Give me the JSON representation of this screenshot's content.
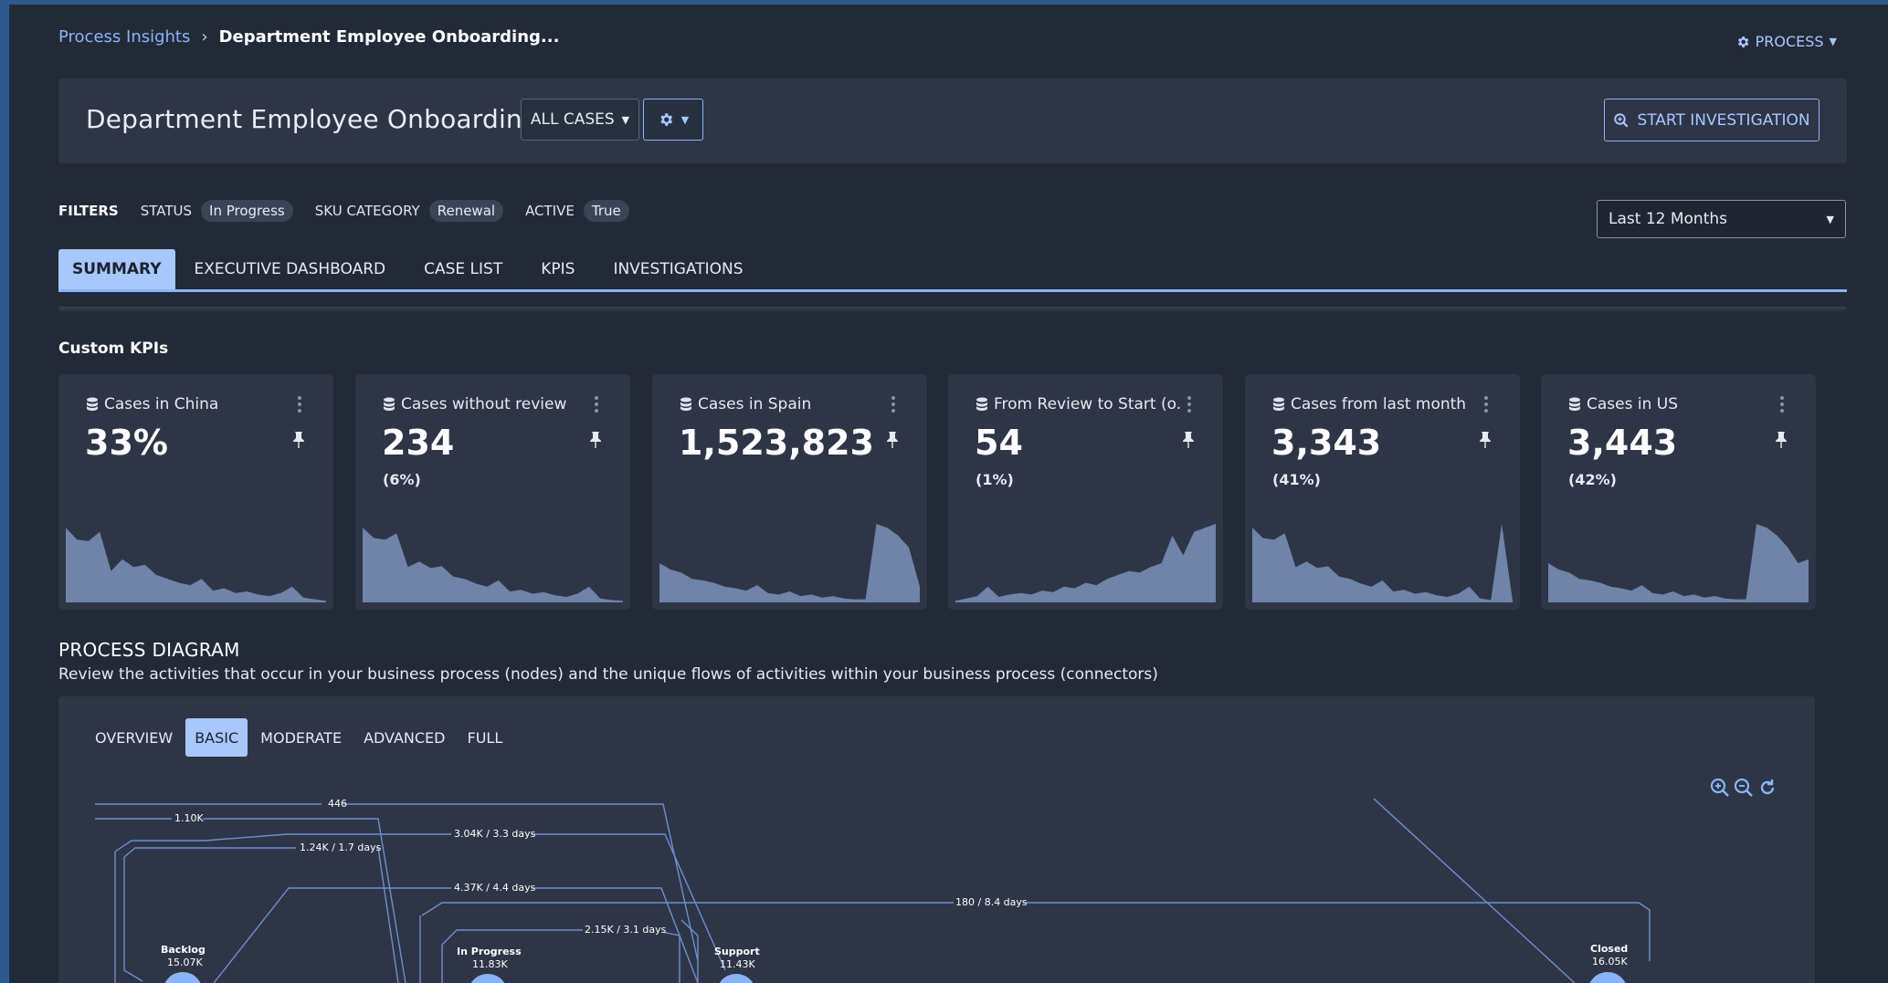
{
  "breadcrumb": {
    "parent": "Process Insights",
    "separator": "›",
    "current": "Department Employee Onboarding..."
  },
  "process_menu": {
    "label": "PROCESS",
    "icon": "gear-icon"
  },
  "header": {
    "title": "Department Employee Onboarding",
    "cases_dropdown": "ALL CASES",
    "settings_icon": "gear-icon",
    "start_investigation": "START INVESTIGATION"
  },
  "filters": {
    "label": "FILTERS",
    "items": [
      {
        "label": "STATUS",
        "value": "In Progress"
      },
      {
        "label": "SKU CATEGORY",
        "value": "Renewal"
      },
      {
        "label": "ACTIVE",
        "value": "True"
      }
    ]
  },
  "date_range": {
    "selected": "Last 12 Months"
  },
  "tabs": [
    {
      "label": "SUMMARY",
      "active": true
    },
    {
      "label": "EXECUTIVE DASHBOARD",
      "active": false
    },
    {
      "label": "CASE LIST",
      "active": false
    },
    {
      "label": "KPIS",
      "active": false
    },
    {
      "label": "INVESTIGATIONS",
      "active": false
    }
  ],
  "custom_kpis": {
    "title": "Custom KPIs",
    "cards": [
      {
        "title": "Cases in China",
        "value": "33%",
        "sub": "",
        "spark": [
          0.95,
          0.8,
          0.78,
          0.9,
          0.4,
          0.55,
          0.45,
          0.48,
          0.35,
          0.3,
          0.25,
          0.22,
          0.3,
          0.15,
          0.18,
          0.12,
          0.14,
          0.1,
          0.08,
          0.12,
          0.2,
          0.06,
          0.04,
          0.02
        ]
      },
      {
        "title": "Cases without review",
        "value": "234",
        "sub": "(6%)",
        "spark": [
          0.95,
          0.82,
          0.8,
          0.88,
          0.45,
          0.52,
          0.44,
          0.46,
          0.33,
          0.3,
          0.24,
          0.2,
          0.28,
          0.14,
          0.16,
          0.11,
          0.13,
          0.09,
          0.07,
          0.11,
          0.2,
          0.05,
          0.03,
          0.02
        ]
      },
      {
        "title": "Cases in Spain",
        "value": "1,523,823",
        "sub": "",
        "spark": [
          0.5,
          0.42,
          0.38,
          0.3,
          0.28,
          0.25,
          0.2,
          0.18,
          0.15,
          0.22,
          0.12,
          0.1,
          0.14,
          0.08,
          0.1,
          0.06,
          0.08,
          0.05,
          0.04,
          0.04,
          1.0,
          0.95,
          0.85,
          0.7,
          0.2
        ]
      },
      {
        "title": "From Review to Start (o...",
        "value": "54",
        "sub": "(1%)",
        "spark": [
          0.02,
          0.05,
          0.08,
          0.2,
          0.07,
          0.1,
          0.12,
          0.1,
          0.15,
          0.13,
          0.2,
          0.18,
          0.25,
          0.22,
          0.3,
          0.35,
          0.4,
          0.38,
          0.45,
          0.5,
          0.85,
          0.6,
          0.9,
          0.95,
          1.0
        ]
      },
      {
        "title": "Cases from last month",
        "value": "3,343",
        "sub": "(41%)",
        "spark": [
          0.95,
          0.82,
          0.8,
          0.88,
          0.45,
          0.52,
          0.44,
          0.46,
          0.33,
          0.3,
          0.24,
          0.2,
          0.28,
          0.14,
          0.16,
          0.11,
          0.13,
          0.09,
          0.07,
          0.11,
          0.2,
          0.05,
          0.03,
          1.0,
          0.02
        ]
      },
      {
        "title": "Cases in US",
        "value": "3,443",
        "sub": "(42%)",
        "spark": [
          0.5,
          0.42,
          0.38,
          0.3,
          0.28,
          0.25,
          0.2,
          0.18,
          0.15,
          0.22,
          0.12,
          0.1,
          0.14,
          0.08,
          0.1,
          0.06,
          0.08,
          0.05,
          0.04,
          0.04,
          1.0,
          0.95,
          0.85,
          0.7,
          0.5,
          0.55
        ]
      }
    ]
  },
  "process_diagram": {
    "title": "PROCESS DIAGRAM",
    "description": "Review the activities that occur in your business process (nodes) and the unique flows of activities within your business process (connectors)",
    "levels": [
      {
        "label": "OVERVIEW",
        "active": false
      },
      {
        "label": "BASIC",
        "active": true
      },
      {
        "label": "MODERATE",
        "active": false
      },
      {
        "label": "ADVANCED",
        "active": false
      },
      {
        "label": "FULL",
        "active": false
      }
    ],
    "zoom_icons": [
      "zoom-in-icon",
      "zoom-out-icon",
      "reset-icon"
    ],
    "edges": [
      "446",
      "1.10K",
      "3.04K / 3.3 days",
      "1.24K / 1.7 days",
      "4.37K / 4.4 days",
      "180 / 8.4 days",
      "2.15K / 3.1 days"
    ],
    "nodes": [
      {
        "name": "Backlog",
        "count": "15.07K"
      },
      {
        "name": "In Progress",
        "count": "11.83K"
      },
      {
        "name": "Support",
        "count": "11.43K"
      },
      {
        "name": "Closed",
        "count": "16.05K"
      }
    ]
  },
  "colors": {
    "accent": "#8ab4f8",
    "active_tab_bg": "#a8c7fa",
    "panel_bg": "#2d3546",
    "page_bg": "#232a37",
    "spark_fill": "#6f84a8",
    "frame": "#2d5a8b"
  }
}
